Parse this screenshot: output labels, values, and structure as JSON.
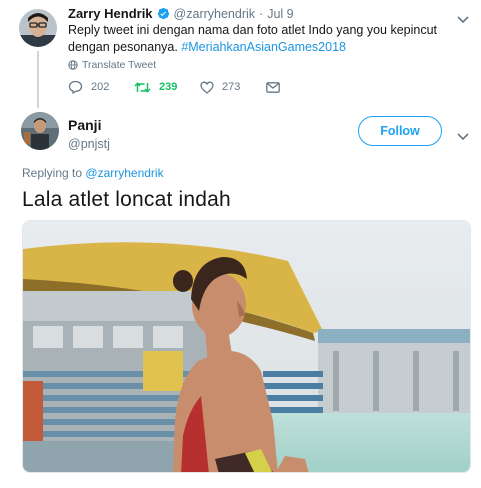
{
  "parent_tweet": {
    "author_name": "Zarry Hendrik",
    "handle": "@zarryhendrik",
    "separator": "·",
    "date": "Jul 9",
    "text": "Reply tweet ini dengan nama dan foto atlet Indo yang you kepincut dengan pesonanya.",
    "hashtag": "#MeriahkanAsianGames2018",
    "translate_label": "Translate Tweet",
    "reply_count": "202",
    "retweet_count": "239",
    "like_count": "273"
  },
  "reply_tweet": {
    "author_name": "Panji",
    "handle": "@pnjstj",
    "follow_label": "Follow",
    "replying_prefix": "Replying to",
    "replying_to": "@zarryhendrik",
    "text": "Lala atlet loncat indah"
  },
  "colors": {
    "link": "#1b95e0",
    "follow": "#1da1f2",
    "retweet_active": "#17bf63",
    "muted": "#657786",
    "verified": "#1da1f2"
  },
  "icons": [
    "verified-badge-icon",
    "chevron-down-icon",
    "globe-icon",
    "reply-icon",
    "retweet-icon",
    "like-icon",
    "message-icon"
  ]
}
